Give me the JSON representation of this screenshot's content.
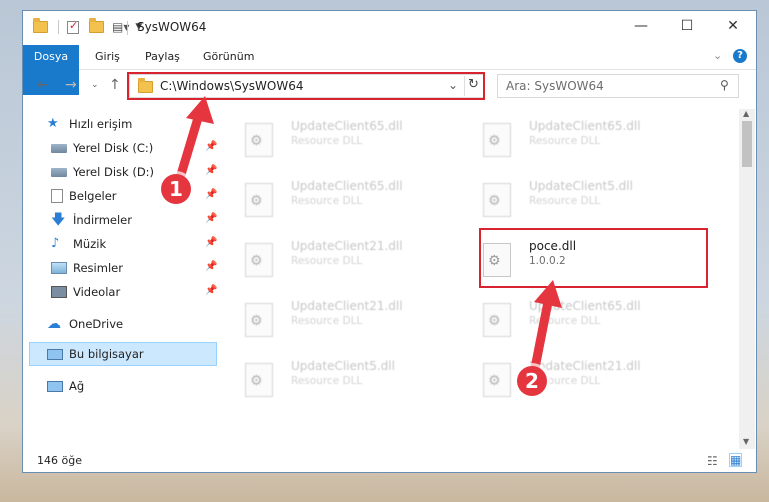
{
  "window": {
    "title": "SysWOW64"
  },
  "ribbon": {
    "tabs": [
      "Dosya",
      "Giriş",
      "Paylaş",
      "Görünüm"
    ]
  },
  "address": {
    "path": "C:\\Windows\\SysWOW64"
  },
  "search": {
    "placeholder": "Ara: SysWOW64"
  },
  "nav": {
    "quick_access": "Hızlı erişim",
    "items": [
      "Yerel Disk (C:)",
      "Yerel Disk (D:)",
      "Belgeler",
      "İndirmeler",
      "Müzik",
      "Resimler",
      "Videolar"
    ],
    "onedrive": "OneDrive",
    "this_pc": "Bu bilgisayar",
    "network": "Ağ"
  },
  "files": [
    {
      "name": "UpdateClient65.dll",
      "desc": "Resource DLL"
    },
    {
      "name": "UpdateClient65.dll",
      "desc": "Resource DLL"
    },
    {
      "name": "UpdateClient65.dll",
      "desc": "Resource DLL"
    },
    {
      "name": "UpdateClient5.dll",
      "desc": "Resource DLL"
    },
    {
      "name": "UpdateClient21.dll",
      "desc": "Resource DLL"
    },
    {
      "name": "poce.dll",
      "desc": "1.0.0.2"
    },
    {
      "name": "UpdateClient21.dll",
      "desc": "Resource DLL"
    },
    {
      "name": "UpdateClient65.dll",
      "desc": "Resource DLL"
    },
    {
      "name": "UpdateClient5.dll",
      "desc": "Resource DLL"
    },
    {
      "name": "UpdateClient21.dll",
      "desc": "Resource DLL"
    }
  ],
  "status": {
    "count": "146 öğe"
  },
  "annotations": {
    "step1": "1",
    "step2": "2"
  },
  "colors": {
    "accent": "#1979ca",
    "highlight": "#d9232f",
    "selection": "#cce8ff"
  }
}
